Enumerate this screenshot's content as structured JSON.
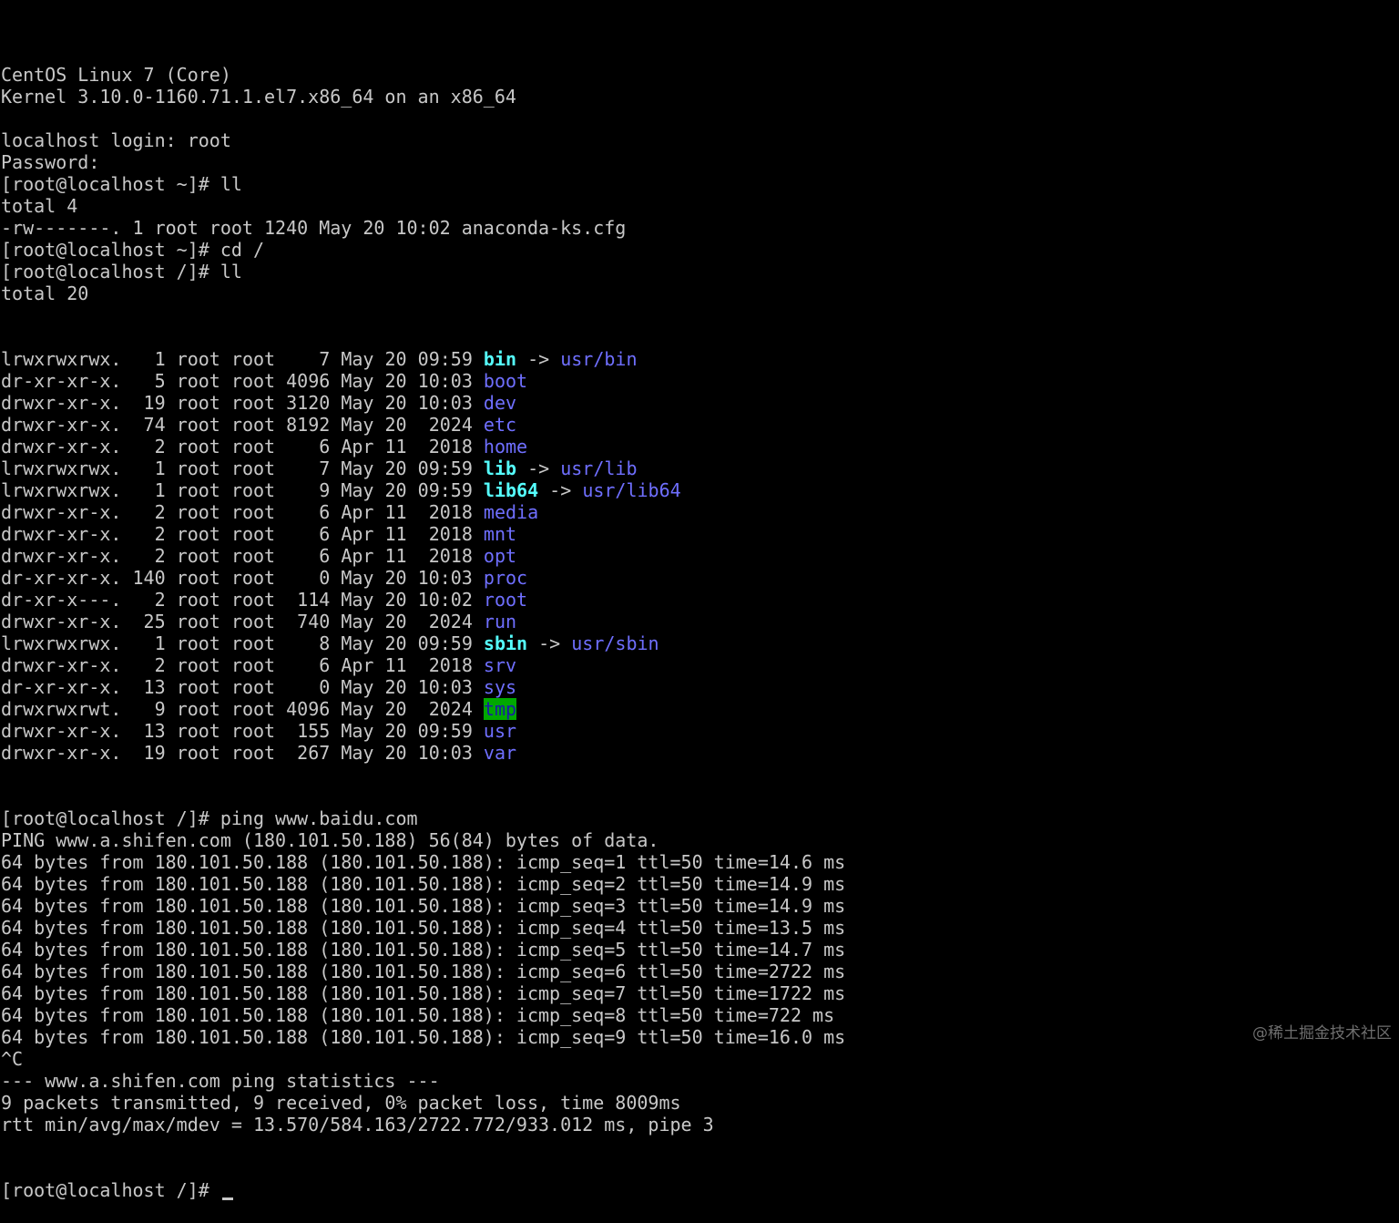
{
  "terminal": {
    "header_lines": [
      "CentOS Linux 7 (Core)",
      "Kernel 3.10.0-1160.71.1.el7.x86_64 on an x86_64",
      "",
      "localhost login: root",
      "Password:",
      "[root@localhost ~]# ll",
      "total 4",
      "-rw-------. 1 root root 1240 May 20 10:02 anaconda-ks.cfg",
      "[root@localhost ~]# cd /",
      "[root@localhost /]# ll",
      "total 20"
    ],
    "ls_entries": [
      {
        "perm": "lrwxrwxrwx.",
        "links": "1",
        "owner": "root",
        "group": "root",
        "size": "7",
        "month": "May",
        "day": "20",
        "time": "09:59",
        "name": "bin",
        "kind": "link",
        "target": "usr/bin"
      },
      {
        "perm": "dr-xr-xr-x.",
        "links": "5",
        "owner": "root",
        "group": "root",
        "size": "4096",
        "month": "May",
        "day": "20",
        "time": "10:03",
        "name": "boot",
        "kind": "dir",
        "target": ""
      },
      {
        "perm": "drwxr-xr-x.",
        "links": "19",
        "owner": "root",
        "group": "root",
        "size": "3120",
        "month": "May",
        "day": "20",
        "time": "10:03",
        "name": "dev",
        "kind": "dir",
        "target": ""
      },
      {
        "perm": "drwxr-xr-x.",
        "links": "74",
        "owner": "root",
        "group": "root",
        "size": "8192",
        "month": "May",
        "day": "20",
        "time": "2024",
        "name": "etc",
        "kind": "dir",
        "target": ""
      },
      {
        "perm": "drwxr-xr-x.",
        "links": "2",
        "owner": "root",
        "group": "root",
        "size": "6",
        "month": "Apr",
        "day": "11",
        "time": "2018",
        "name": "home",
        "kind": "dir",
        "target": ""
      },
      {
        "perm": "lrwxrwxrwx.",
        "links": "1",
        "owner": "root",
        "group": "root",
        "size": "7",
        "month": "May",
        "day": "20",
        "time": "09:59",
        "name": "lib",
        "kind": "link",
        "target": "usr/lib"
      },
      {
        "perm": "lrwxrwxrwx.",
        "links": "1",
        "owner": "root",
        "group": "root",
        "size": "9",
        "month": "May",
        "day": "20",
        "time": "09:59",
        "name": "lib64",
        "kind": "link",
        "target": "usr/lib64"
      },
      {
        "perm": "drwxr-xr-x.",
        "links": "2",
        "owner": "root",
        "group": "root",
        "size": "6",
        "month": "Apr",
        "day": "11",
        "time": "2018",
        "name": "media",
        "kind": "dir",
        "target": ""
      },
      {
        "perm": "drwxr-xr-x.",
        "links": "2",
        "owner": "root",
        "group": "root",
        "size": "6",
        "month": "Apr",
        "day": "11",
        "time": "2018",
        "name": "mnt",
        "kind": "dir",
        "target": ""
      },
      {
        "perm": "drwxr-xr-x.",
        "links": "2",
        "owner": "root",
        "group": "root",
        "size": "6",
        "month": "Apr",
        "day": "11",
        "time": "2018",
        "name": "opt",
        "kind": "dir",
        "target": ""
      },
      {
        "perm": "dr-xr-xr-x.",
        "links": "140",
        "owner": "root",
        "group": "root",
        "size": "0",
        "month": "May",
        "day": "20",
        "time": "10:03",
        "name": "proc",
        "kind": "dir",
        "target": ""
      },
      {
        "perm": "dr-xr-x---.",
        "links": "2",
        "owner": "root",
        "group": "root",
        "size": "114",
        "month": "May",
        "day": "20",
        "time": "10:02",
        "name": "root",
        "kind": "dir",
        "target": ""
      },
      {
        "perm": "drwxr-xr-x.",
        "links": "25",
        "owner": "root",
        "group": "root",
        "size": "740",
        "month": "May",
        "day": "20",
        "time": "2024",
        "name": "run",
        "kind": "dir",
        "target": ""
      },
      {
        "perm": "lrwxrwxrwx.",
        "links": "1",
        "owner": "root",
        "group": "root",
        "size": "8",
        "month": "May",
        "day": "20",
        "time": "09:59",
        "name": "sbin",
        "kind": "link",
        "target": "usr/sbin"
      },
      {
        "perm": "drwxr-xr-x.",
        "links": "2",
        "owner": "root",
        "group": "root",
        "size": "6",
        "month": "Apr",
        "day": "11",
        "time": "2018",
        "name": "srv",
        "kind": "dir",
        "target": ""
      },
      {
        "perm": "dr-xr-xr-x.",
        "links": "13",
        "owner": "root",
        "group": "root",
        "size": "0",
        "month": "May",
        "day": "20",
        "time": "10:03",
        "name": "sys",
        "kind": "dir",
        "target": ""
      },
      {
        "perm": "drwxrwxrwt.",
        "links": "9",
        "owner": "root",
        "group": "root",
        "size": "4096",
        "month": "May",
        "day": "20",
        "time": "2024",
        "name": "tmp",
        "kind": "sticky",
        "target": ""
      },
      {
        "perm": "drwxr-xr-x.",
        "links": "13",
        "owner": "root",
        "group": "root",
        "size": "155",
        "month": "May",
        "day": "20",
        "time": "09:59",
        "name": "usr",
        "kind": "dir",
        "target": ""
      },
      {
        "perm": "drwxr-xr-x.",
        "links": "19",
        "owner": "root",
        "group": "root",
        "size": "267",
        "month": "May",
        "day": "20",
        "time": "10:03",
        "name": "var",
        "kind": "dir",
        "target": ""
      }
    ],
    "ping_lines": [
      "[root@localhost /]# ping www.baidu.com",
      "PING www.a.shifen.com (180.101.50.188) 56(84) bytes of data.",
      "64 bytes from 180.101.50.188 (180.101.50.188): icmp_seq=1 ttl=50 time=14.6 ms",
      "64 bytes from 180.101.50.188 (180.101.50.188): icmp_seq=2 ttl=50 time=14.9 ms",
      "64 bytes from 180.101.50.188 (180.101.50.188): icmp_seq=3 ttl=50 time=14.9 ms",
      "64 bytes from 180.101.50.188 (180.101.50.188): icmp_seq=4 ttl=50 time=13.5 ms",
      "64 bytes from 180.101.50.188 (180.101.50.188): icmp_seq=5 ttl=50 time=14.7 ms",
      "64 bytes from 180.101.50.188 (180.101.50.188): icmp_seq=6 ttl=50 time=2722 ms",
      "64 bytes from 180.101.50.188 (180.101.50.188): icmp_seq=7 ttl=50 time=1722 ms",
      "64 bytes from 180.101.50.188 (180.101.50.188): icmp_seq=8 ttl=50 time=722 ms",
      "64 bytes from 180.101.50.188 (180.101.50.188): icmp_seq=9 ttl=50 time=16.0 ms",
      "^C",
      "--- www.a.shifen.com ping statistics ---",
      "9 packets transmitted, 9 received, 0% packet loss, time 8009ms",
      "rtt min/avg/max/mdev = 13.570/584.163/2722.772/933.012 ms, pipe 3"
    ],
    "final_prompt": "[root@localhost /]# ",
    "colors": {
      "background": "#000000",
      "foreground": "#c8c8c8",
      "directory": "#6f6fff",
      "symlink": "#55ffff",
      "sticky_bg": "#00a800",
      "sticky_fg": "#1a1aa8"
    }
  },
  "watermark": {
    "text": "@稀土掘金技术社区"
  }
}
